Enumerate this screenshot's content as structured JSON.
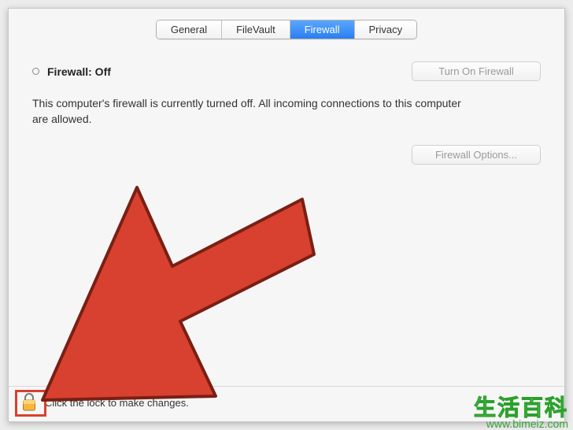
{
  "tabs": {
    "general": {
      "label": "General",
      "selected": false
    },
    "filevault": {
      "label": "FileVault",
      "selected": false
    },
    "firewall": {
      "label": "Firewall",
      "selected": true
    },
    "privacy": {
      "label": "Privacy",
      "selected": false
    }
  },
  "status": {
    "label": "Firewall: Off"
  },
  "buttons": {
    "turn_on": "Turn On Firewall",
    "options": "Firewall Options..."
  },
  "description": "This computer's firewall is currently turned off. All incoming connections to this computer are allowed.",
  "lock": {
    "hint": "Click the lock to make changes."
  },
  "watermark": {
    "brand": "生活百科",
    "url": "www.bimeiz.com"
  },
  "colors": {
    "accent": "#2a7ef0",
    "arrow": "#d8412f",
    "disabled": "#9a9a9a"
  }
}
